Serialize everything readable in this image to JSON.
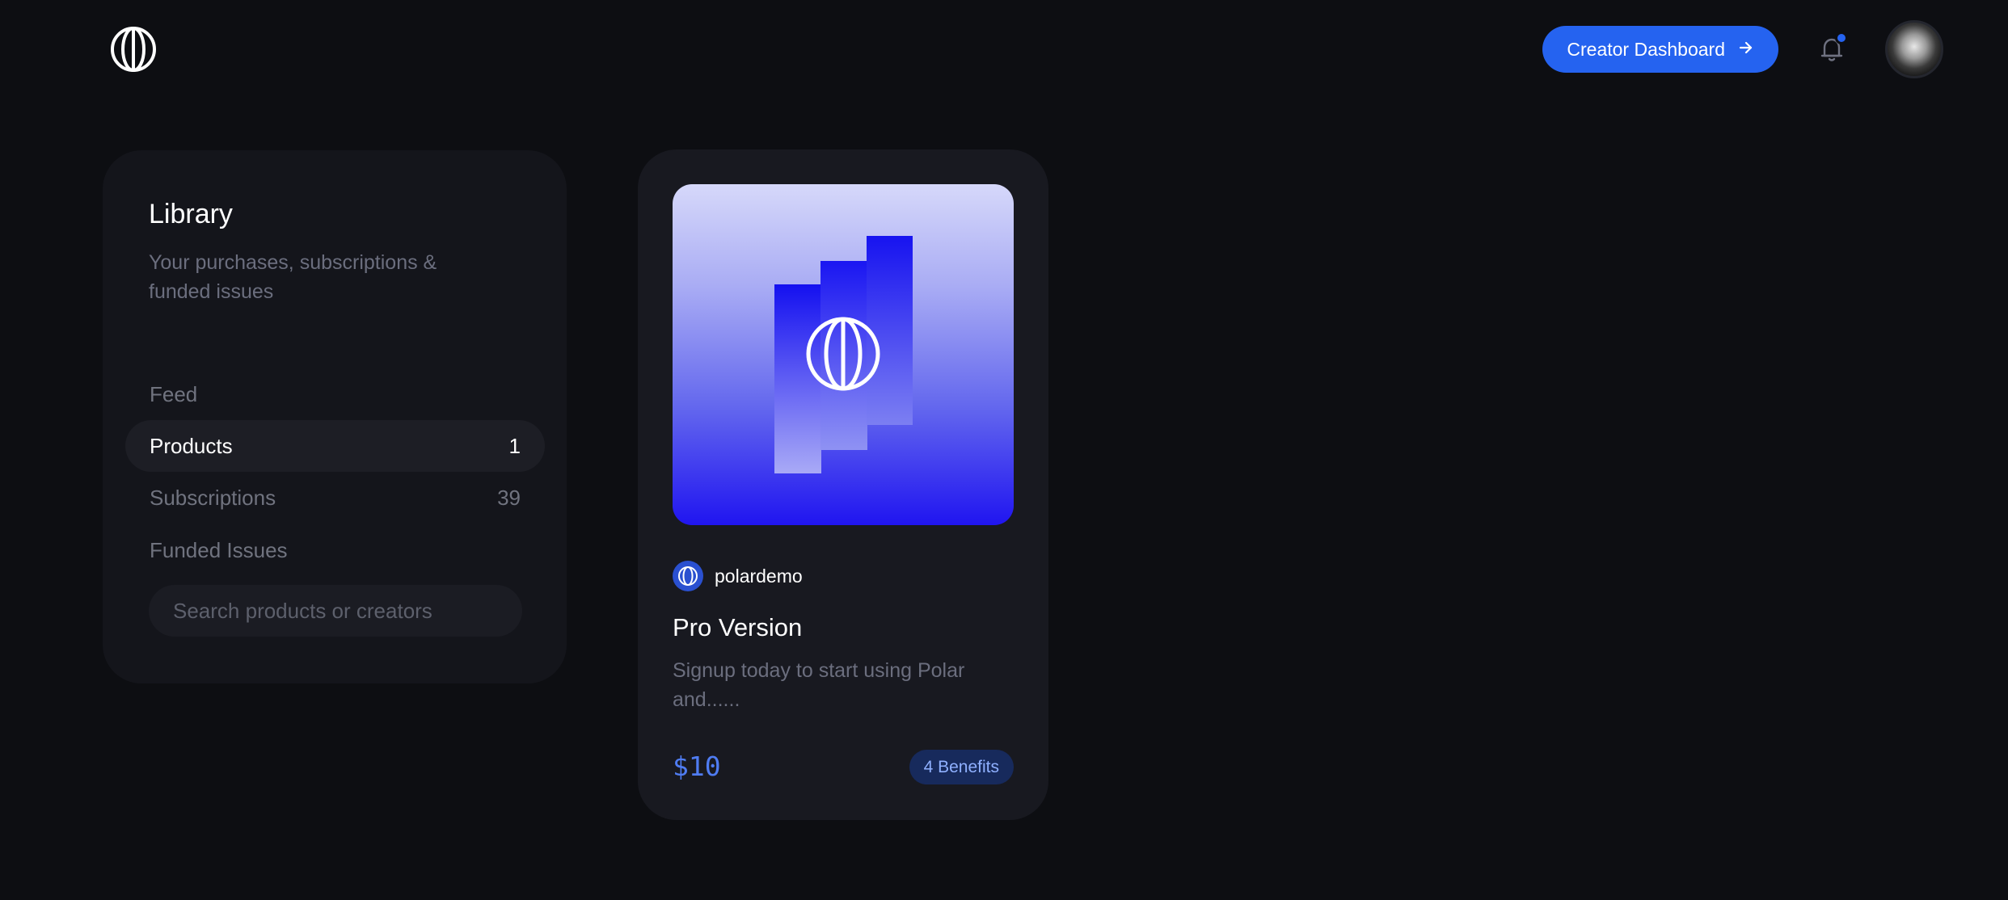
{
  "header": {
    "logo_icon": "polar-logo-icon",
    "dashboard_button_label": "Creator Dashboard",
    "dashboard_button_icon": "arrow-right-icon",
    "notification_icon": "bell-icon",
    "accent_color": "#2563f0"
  },
  "sidebar": {
    "title": "Library",
    "subtitle": "Your purchases, subscriptions & funded issues",
    "items": [
      {
        "label": "Feed",
        "count": ""
      },
      {
        "label": "Products",
        "count": "1",
        "active": true
      },
      {
        "label": "Subscriptions",
        "count": "39"
      },
      {
        "label": "Funded Issues",
        "count": ""
      }
    ],
    "search_placeholder": "Search products or creators"
  },
  "product": {
    "seller": "polardemo",
    "title": "Pro Version",
    "description": "Signup today to start using Polar and......",
    "price": "$10",
    "benefits": "4 Benefits"
  }
}
